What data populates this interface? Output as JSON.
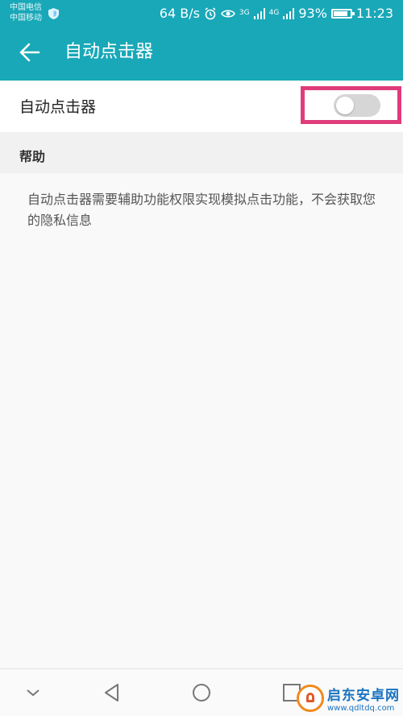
{
  "status_bar": {
    "carrier1": "中国电信",
    "carrier2": "中国移动",
    "net_speed": "64 B/s",
    "net1": "3G",
    "net2": "4G",
    "battery": "93%",
    "battery_level": 0.93,
    "time": "11:23"
  },
  "app_bar": {
    "title": "自动点击器"
  },
  "toggle_row": {
    "label": "自动点击器",
    "enabled": false
  },
  "help": {
    "title": "帮助",
    "text": "自动点击器需要辅助功能权限实现模拟点击功能，不会获取您的隐私信息"
  },
  "watermark": {
    "name": "启东安卓网",
    "url": "www.qdltdq.com"
  },
  "colors": {
    "accent": "#18a8b8",
    "highlight": "#e03c7b"
  }
}
